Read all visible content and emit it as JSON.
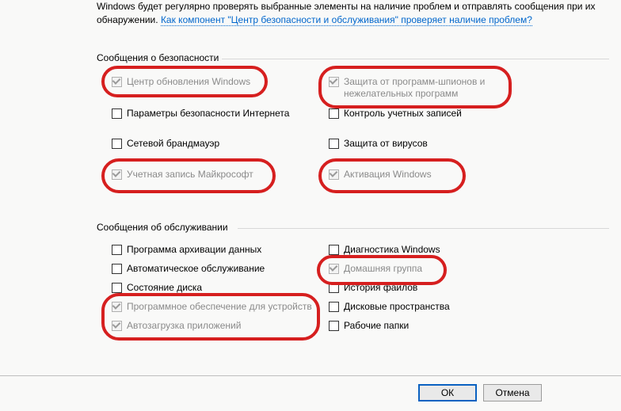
{
  "intro": {
    "text": "Windows будет регулярно проверять выбранные элементы на наличие проблем и отправлять сообщения при их обнаружении. ",
    "link": "Как компонент \"Центр безопасности и обслуживания\" проверяет наличие проблем?"
  },
  "sections": {
    "security_title": "Сообщения о безопасности",
    "maintenance_title": "Сообщения об обслуживании"
  },
  "security": {
    "windows_update": "Центр обновления Windows",
    "internet_security": "Параметры безопасности Интернета",
    "firewall": "Сетевой брандмауэр",
    "microsoft_account": "Учетная запись Майкрософт",
    "spyware": "Защита от программ-шпионов и\nнежелательных программ",
    "uac": "Контроль учетных записей",
    "virus": "Защита от вирусов",
    "activation": "Активация Windows"
  },
  "maintenance": {
    "backup": "Программа архивации данных",
    "auto_maint": "Автоматическое обслуживание",
    "disk_state": "Состояние диска",
    "device_soft": "Программное обеспечение для устройств",
    "startup_apps": "Автозагрузка приложений",
    "diagnostics": "Диагностика Windows",
    "homegroup": "Домашняя группа",
    "file_history": "История файлов",
    "storage_spaces": "Дисковые пространства",
    "work_folders": "Рабочие папки"
  },
  "buttons": {
    "ok": "ОК",
    "cancel": "Отмена"
  }
}
